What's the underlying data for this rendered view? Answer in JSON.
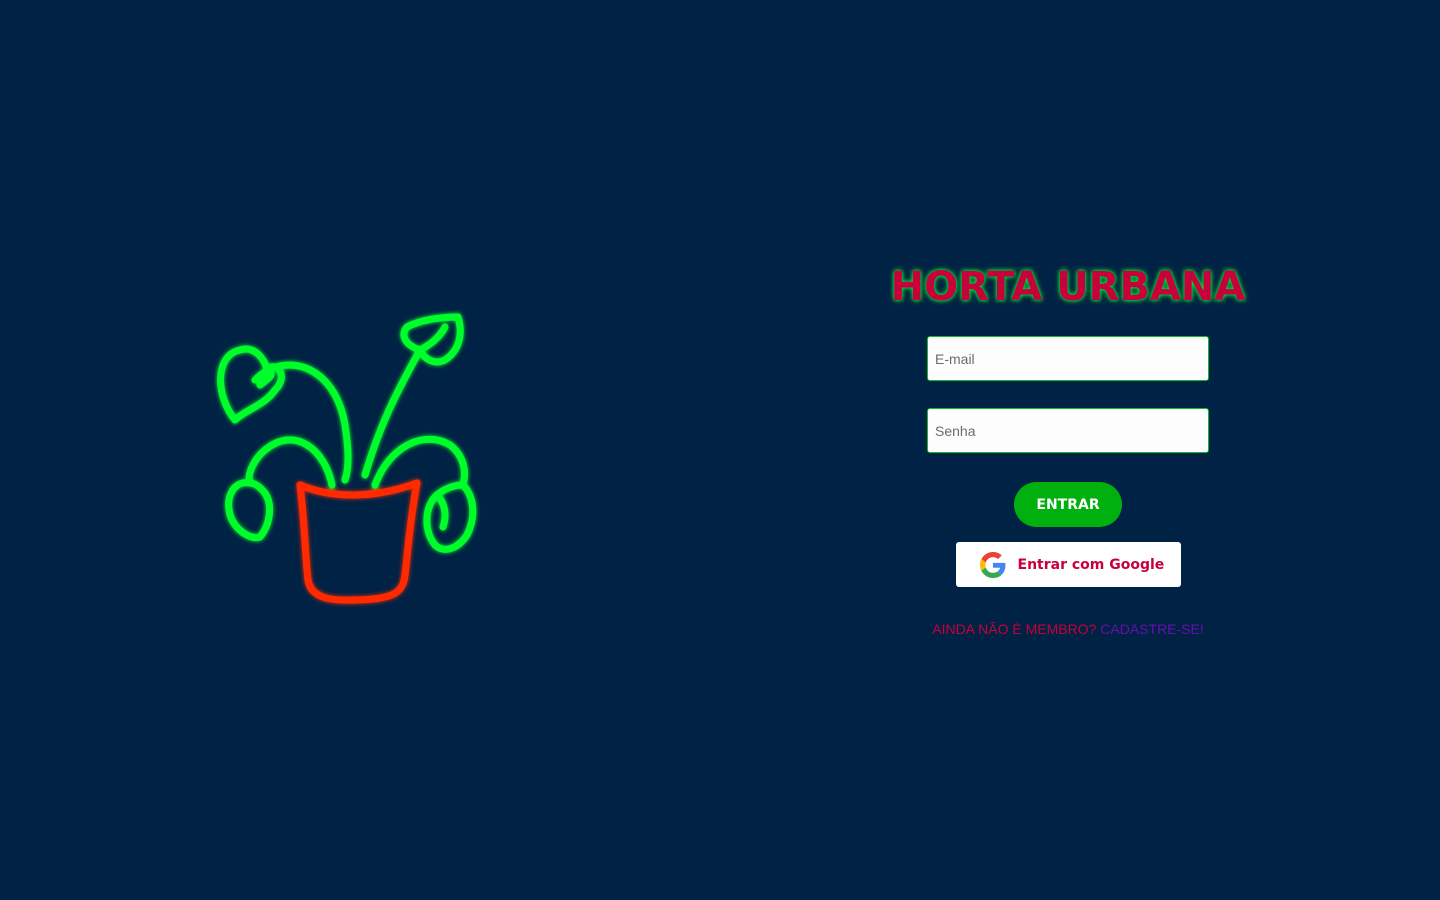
{
  "app": {
    "title": "HORTA URBANA"
  },
  "login_form": {
    "email_placeholder": "E-mail",
    "password_placeholder": "Senha",
    "submit_label": "ENTRAR",
    "google_label": "Entrar com Google"
  },
  "signup": {
    "prompt": "AINDA NÃO É MEMBRO?",
    "link_label": "CADASTRE-SE!"
  },
  "illustration": {
    "icon": "potted-plant-neon-icon"
  },
  "colors": {
    "background": "#002244",
    "brand": "#c8003c",
    "accent_green": "#00b00f",
    "link": "#6a0dad",
    "leaf_neon": "#00ff2a",
    "pot_neon": "#ff2a00"
  }
}
